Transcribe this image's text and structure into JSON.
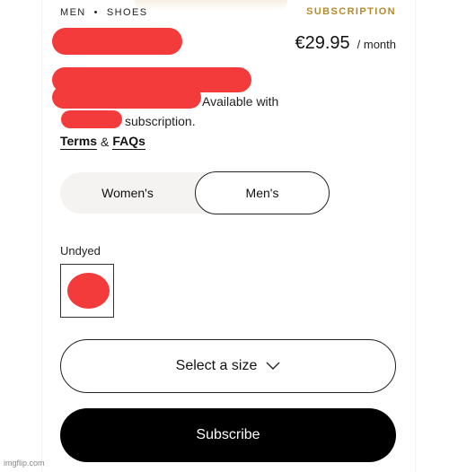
{
  "breadcrumb": {
    "items": [
      "MEN",
      "SHOES"
    ],
    "separator": "•"
  },
  "header": {
    "subscription_link": "SUBSCRIPTION"
  },
  "pricing": {
    "price": "€29.95",
    "period": "/ month"
  },
  "availability": {
    "line1": "Available with",
    "line2": "subscription."
  },
  "links": {
    "terms": "Terms",
    "and": "&",
    "faqs": "FAQs"
  },
  "gender": {
    "options": [
      "Women's",
      "Men's"
    ],
    "selected": "Men's"
  },
  "color": {
    "label": "Undyed"
  },
  "size": {
    "label": "Select a size"
  },
  "cta": {
    "subscribe": "Subscribe"
  },
  "watermark": "imgflip.com",
  "colors": {
    "accent": "#b48a2e",
    "redaction": "#f43b3b",
    "button": "#000000"
  }
}
